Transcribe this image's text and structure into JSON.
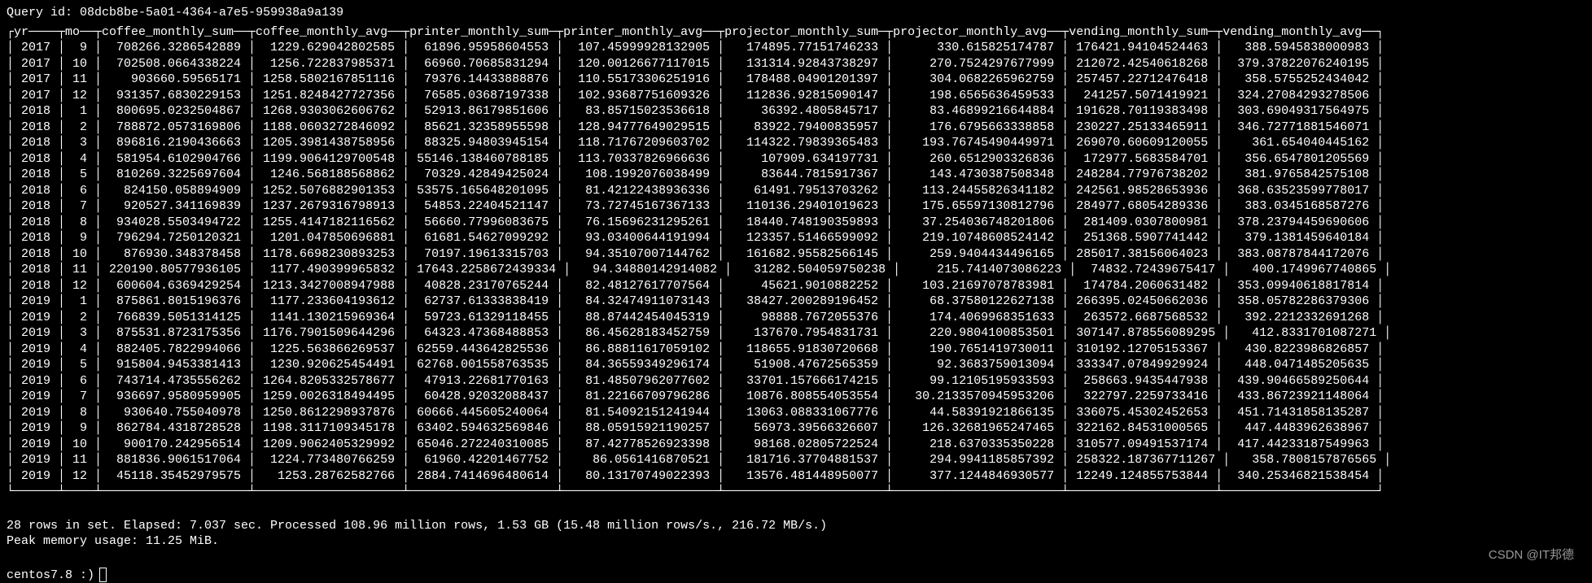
{
  "query_label": "Query id:",
  "query_id": "08dcb8be-5a01-4364-a7e5-959938a9a139",
  "status1": "28 rows in set. Elapsed: 7.037 sec. Processed 108.96 million rows, 1.53 GB (15.48 million rows/s., 216.72 MB/s.)",
  "status2": "Peak memory usage: 11.25 MiB.",
  "prompt": "centos7.8 :)",
  "watermark": "CSDN @IT邦德",
  "columns": [
    "yr",
    "mo",
    "coffee_monthly_sum",
    "coffee_monthly_avg",
    "printer_monthly_sum",
    "printer_monthly_avg",
    "projector_monthly_sum",
    "projector_monthly_avg",
    "vending_monthly_sum",
    "vending_monthly_avg"
  ],
  "rows": [
    [
      "2017",
      "9",
      "708266.3286542889",
      "1229.629042802585",
      "61896.95958604553",
      "107.45999928132905",
      "174895.77151746233",
      "330.615825174787",
      "176421.94104524463",
      "388.5945838000983"
    ],
    [
      "2017",
      "10",
      "702508.0664338224",
      "1256.722837985371",
      "66960.70685831294",
      "120.00126677117015",
      "131314.92843738297",
      "270.7524297677999",
      "212072.42540618268",
      "379.37822076240195"
    ],
    [
      "2017",
      "11",
      "903660.59565171",
      "1258.5802167851116",
      "79376.14433888876",
      "110.55173306251916",
      "178488.04901201397",
      "304.0682265962759",
      "257457.22712476418",
      "358.5755252434042"
    ],
    [
      "2017",
      "12",
      "931357.6830229153",
      "1251.8248427727356",
      "76585.03687197338",
      "102.93687751609326",
      "112836.92815090147",
      "198.6565636459533",
      "241257.5071419921",
      "324.27084293278506"
    ],
    [
      "2018",
      "1",
      "800695.0232504867",
      "1268.9303062606762",
      "52913.86179851606",
      "83.85715023536618",
      "36392.4805845717",
      "83.46899216644884",
      "191628.70119383498",
      "303.69049317564975"
    ],
    [
      "2018",
      "2",
      "788872.0573169806",
      "1188.0603272846092",
      "85621.32358955598",
      "128.94777649029515",
      "83922.79400835957",
      "176.6795663338858",
      "230227.25133465911",
      "346.72771881546071"
    ],
    [
      "2018",
      "3",
      "896816.2190436663",
      "1205.3981438758956",
      "88325.94803945154",
      "118.71767209603702",
      "114322.79839365483",
      "193.76745490449971",
      "269070.60609120055",
      "361.654040445162"
    ],
    [
      "2018",
      "4",
      "581954.6102904766",
      "1199.9064129700548",
      "55146.138460788185",
      "113.70337826966636",
      "107909.634197731",
      "260.6512903326836",
      "172977.5683584701",
      "356.6547801205569"
    ],
    [
      "2018",
      "5",
      "810269.3225697604",
      "1246.568188568862",
      "70329.42849425024",
      "108.1992076038499",
      "83644.7815917367",
      "143.4730387508348",
      "248284.77976738202",
      "381.9765842575108"
    ],
    [
      "2018",
      "6",
      "824150.058894909",
      "1252.5076882901353",
      "53575.165648201095",
      "81.42122438936336",
      "61491.79513703262",
      "113.24455826341182",
      "242561.98528653936",
      "368.63523599778017"
    ],
    [
      "2018",
      "7",
      "920527.341169839",
      "1237.2679316798913",
      "54853.22404521147",
      "73.72745167367133",
      "110136.29401019623",
      "175.65597130812796",
      "284977.68054289336",
      "383.0345168587276"
    ],
    [
      "2018",
      "8",
      "934028.5503494722",
      "1255.4147182116562",
      "56660.77996083675",
      "76.15696231295261",
      "18440.748190359893",
      "37.254036748201806",
      "281409.0307800981",
      "378.23794459690606"
    ],
    [
      "2018",
      "9",
      "796294.7250120321",
      "1201.047850696881",
      "61681.54627099292",
      "93.03400644191994",
      "123357.51466599092",
      "219.10748608524142",
      "251368.5907741442",
      "379.1381459640184"
    ],
    [
      "2018",
      "10",
      "876930.348378458",
      "1178.6698230893253",
      "70197.19613315703",
      "94.35107007144762",
      "161682.95582566145",
      "259.9404434496165",
      "285017.38156064023",
      "383.08787844172076"
    ],
    [
      "2018",
      "11",
      "220190.80577936105",
      "1177.490399965832",
      "17643.2258672439334",
      "94.34880142914082",
      "31282.504059750238",
      "215.7414073086223",
      "74832.72439675417",
      "400.1749967740865"
    ],
    [
      "2018",
      "12",
      "600604.6369429254",
      "1213.3427008947988",
      "40828.23170765244",
      "82.48127617707564",
      "45621.9010882252",
      "103.21697078783981",
      "174784.2060631482",
      "353.09940618817814"
    ],
    [
      "2019",
      "1",
      "875861.8015196376",
      "1177.233604193612",
      "62737.61333838419",
      "84.32474911073143",
      "38427.200289196452",
      "68.37580122627138",
      "266395.02450662036",
      "358.05782286379306"
    ],
    [
      "2019",
      "2",
      "766839.5051314125",
      "1141.130215969364",
      "59723.61329118455",
      "88.87442454045319",
      "98888.7672055376",
      "174.4069968351633",
      "263572.6687568532",
      "392.2212332691268"
    ],
    [
      "2019",
      "3",
      "875531.8723175356",
      "1176.7901509644296",
      "64323.47368488853",
      "86.45628183452759",
      "137670.7954831731",
      "220.9804100853501",
      "307147.878556089295",
      "412.8331701087271"
    ],
    [
      "2019",
      "4",
      "882405.7822994066",
      "1225.563866269537",
      "62559.443642825536",
      "86.88811617059102",
      "118655.91830720668",
      "190.7651419730011",
      "310192.12705153367",
      "430.8223986826857"
    ],
    [
      "2019",
      "5",
      "915804.9453381413",
      "1230.920625454491",
      "62768.001558763535",
      "84.36559349296174",
      "51908.47672565359",
      "92.3683759013094",
      "333347.07849929924",
      "448.0471485205635"
    ],
    [
      "2019",
      "6",
      "743714.4735556262",
      "1264.8205332578677",
      "47913.22681770163",
      "81.48507962077602",
      "33701.157666174215",
      "99.12105195933593",
      "258663.9435447938",
      "439.90466589250644"
    ],
    [
      "2019",
      "7",
      "936697.9580959905",
      "1259.0026318494495",
      "60428.92032088437",
      "81.22166709796286",
      "10876.808554053554",
      "30.2133570945953206",
      "322797.2259733416",
      "433.86723921148064"
    ],
    [
      "2019",
      "8",
      "930640.755040978",
      "1250.8612298937876",
      "60666.445605240064",
      "81.54092151241944",
      "13063.088331067776",
      "44.58391921866135",
      "336075.45302452653",
      "451.71431858135287"
    ],
    [
      "2019",
      "9",
      "862784.4318728528",
      "1198.3117109345178",
      "63402.594632569846",
      "88.05915921190257",
      "56973.39566326607",
      "126.32681965247465",
      "322162.84531000565",
      "447.4483962638967"
    ],
    [
      "2019",
      "10",
      "900170.242956514",
      "1209.9062405329992",
      "65046.272240310085",
      "87.42778526923398",
      "98168.02805722524",
      "218.6370335350228",
      "310577.09491537174",
      "417.44233187549963"
    ],
    [
      "2019",
      "11",
      "881836.9061517064",
      "1224.773480766259",
      "61960.42201467752",
      "86.0561416870521",
      "181716.37704881537",
      "294.9941185857392",
      "258322.187367711267",
      "358.7808157876565"
    ],
    [
      "2019",
      "12",
      "45118.35452979575",
      "1253.28762582766",
      "2884.7414696480614",
      "80.13170749022393",
      "13576.481448950077",
      "377.1244846930577",
      "12249.124855753844",
      "340.25346821538454"
    ]
  ],
  "widths": [
    6,
    4,
    20,
    20,
    20,
    21,
    22,
    23,
    20,
    21
  ],
  "chart_data": {
    "type": "table",
    "title": "Monthly aggregates",
    "columns": [
      "yr",
      "mo",
      "coffee_monthly_sum",
      "coffee_monthly_avg",
      "printer_monthly_sum",
      "printer_monthly_avg",
      "projector_monthly_sum",
      "projector_monthly_avg",
      "vending_monthly_sum",
      "vending_monthly_avg"
    ]
  }
}
